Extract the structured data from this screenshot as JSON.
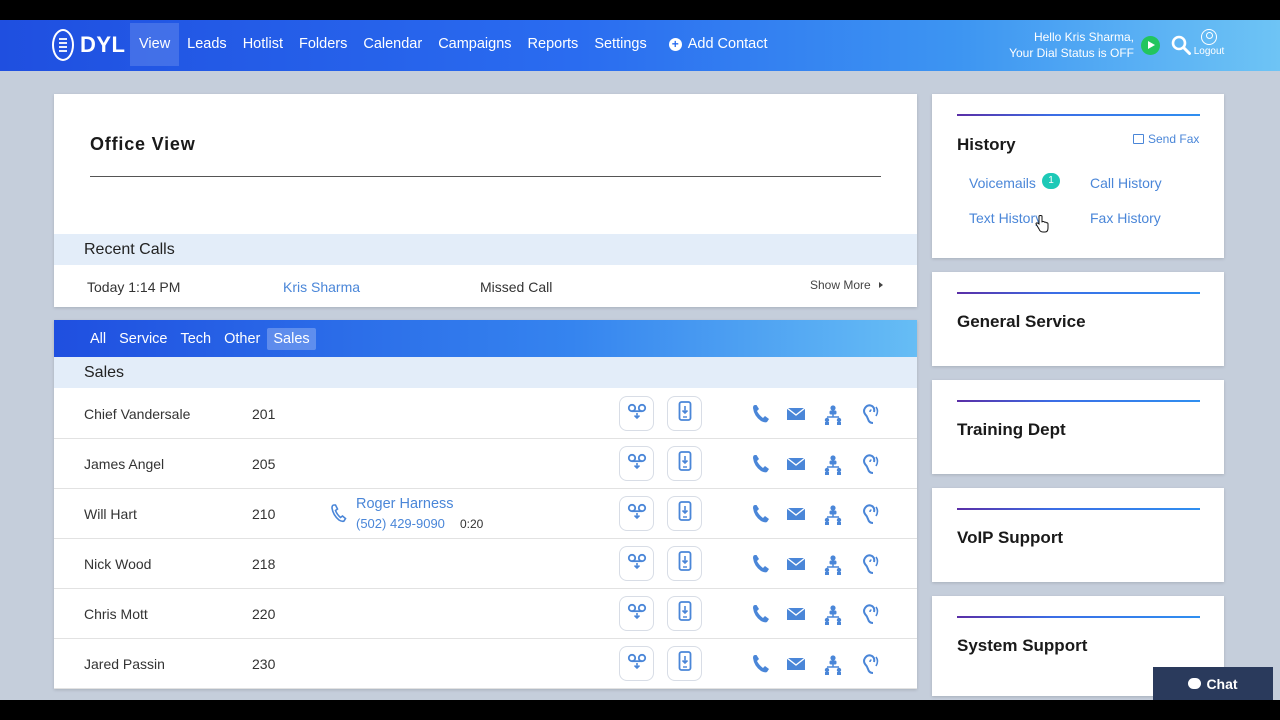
{
  "header": {
    "logo": "DYL",
    "nav": [
      "View",
      "Leads",
      "Hotlist",
      "Folders",
      "Calendar",
      "Campaigns",
      "Reports",
      "Settings"
    ],
    "add_contact": "Add Contact",
    "greeting": "Hello Kris Sharma,",
    "dial_status": "Your Dial Status is OFF",
    "logout": "Logout"
  },
  "office": {
    "title": "Office View",
    "recent_title": "Recent Calls",
    "recent": {
      "time": "Today 1:14 PM",
      "name": "Kris Sharma",
      "status": "Missed Call"
    },
    "show_more": "Show More"
  },
  "list": {
    "tabs": [
      "All",
      "Service",
      "Tech",
      "Other",
      "Sales"
    ],
    "active_tab": "Sales",
    "section": "Sales",
    "rows": [
      {
        "name": "Chief Vandersale",
        "ext": "201"
      },
      {
        "name": "James Angel",
        "ext": "205"
      },
      {
        "name": "Will Hart",
        "ext": "210",
        "call": {
          "name": "Roger Harness",
          "number": "(502) 429-9090",
          "duration": "0:20"
        }
      },
      {
        "name": "Nick Wood",
        "ext": "218"
      },
      {
        "name": "Chris Mott",
        "ext": "220"
      },
      {
        "name": "Jared Passin",
        "ext": "230"
      }
    ]
  },
  "history": {
    "title": "History",
    "send_fax": "Send Fax",
    "voicemails": "Voicemails",
    "voicemail_count": "1",
    "call_history": "Call History",
    "text_history": "Text History",
    "fax_history": "Fax History"
  },
  "departments": [
    "General Service",
    "Training Dept",
    "VoIP Support",
    "System Support"
  ],
  "chat": "Chat",
  "colors": {
    "accent": "#2a6cf0",
    "link": "#4a86d8",
    "badge": "#1dc9b7",
    "status_on": "#22c55e"
  }
}
